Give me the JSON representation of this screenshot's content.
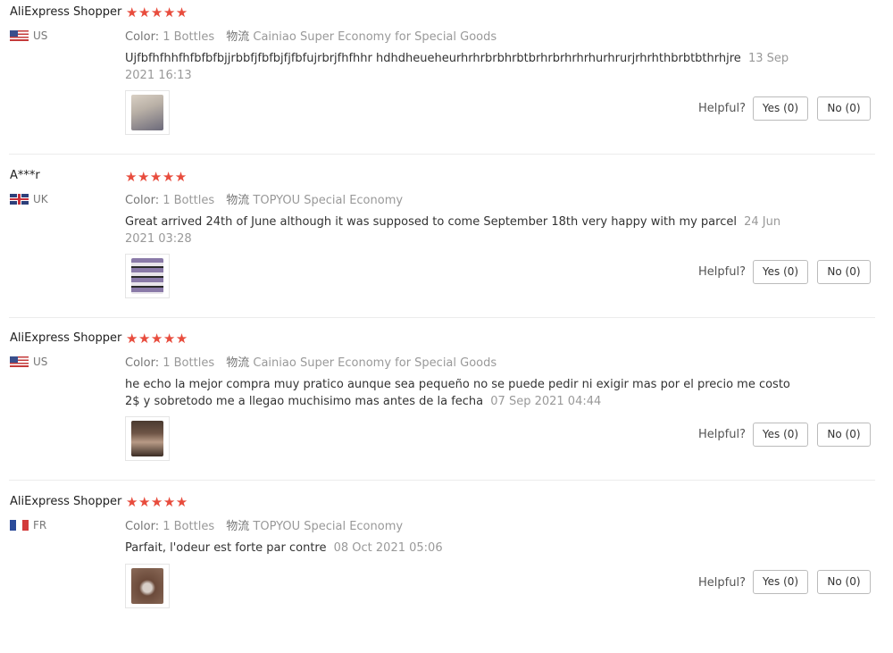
{
  "labels": {
    "color": "Color:",
    "shipping": "物流",
    "helpful": "Helpful?",
    "stars": "★★★★★"
  },
  "reviews": [
    {
      "user": "AliExpress Shopper",
      "rating": 5,
      "country_code": "US",
      "flag": "us",
      "color_value": "1 Bottles",
      "shipping_method": "Cainiao Super Economy for Special Goods",
      "text": "Ujfbfhfhhfhfbfbfbjjrbbfjfbfbjfjfbfujrbrjfhfhhr hdhdheueheurhrhrbrbhrbtbrhrbrhrhrhurhrurjrhrhthbrbtbthrhjre",
      "date": "13 Sep 2021 16:13",
      "yes_label": "Yes (0)",
      "no_label": "No (0)",
      "photo_colors": [
        "#d9d0c4",
        "#6c6a7a"
      ]
    },
    {
      "user": "A***r",
      "rating": 5,
      "country_code": "UK",
      "flag": "uk",
      "color_value": "1 Bottles",
      "shipping_method": "TOPYOU Special Economy",
      "text": "Great arrived 24th of June although it was supposed to come September 18th very happy with my parcel",
      "date": "24 Jun 2021 03:28",
      "yes_label": "Yes (0)",
      "no_label": "No (0)",
      "photo_colors": [
        "#8a7aa8",
        "#e8e4ea"
      ]
    },
    {
      "user": "AliExpress Shopper",
      "rating": 5,
      "country_code": "US",
      "flag": "us",
      "color_value": "1 Bottles",
      "shipping_method": "Cainiao Super Economy for Special Goods",
      "text": "he echo la mejor compra muy pratico aunque sea pequeño no se puede pedir ni exigir mas por el precio me costo 2$ y sobretodo me a llegao muchisimo mas antes de la fecha",
      "date": "07 Sep 2021 04:44",
      "yes_label": "Yes (0)",
      "no_label": "No (0)",
      "photo_colors": [
        "#4a3a30",
        "#b89a86"
      ]
    },
    {
      "user": "AliExpress Shopper",
      "rating": 5,
      "country_code": "FR",
      "flag": "fr",
      "color_value": "1 Bottles",
      "shipping_method": "TOPYOU Special Economy",
      "text": "Parfait, l'odeur est forte par contre",
      "date": "08 Oct 2021 05:06",
      "yes_label": "Yes (0)",
      "no_label": "No (0)",
      "photo_colors": [
        "#6b4a3a",
        "#d8cfc8"
      ]
    }
  ],
  "colors": {
    "star": "#e84c3d",
    "flag_fr": [
      "#2b4b9a",
      "#ffffff",
      "#d23a3a"
    ]
  }
}
